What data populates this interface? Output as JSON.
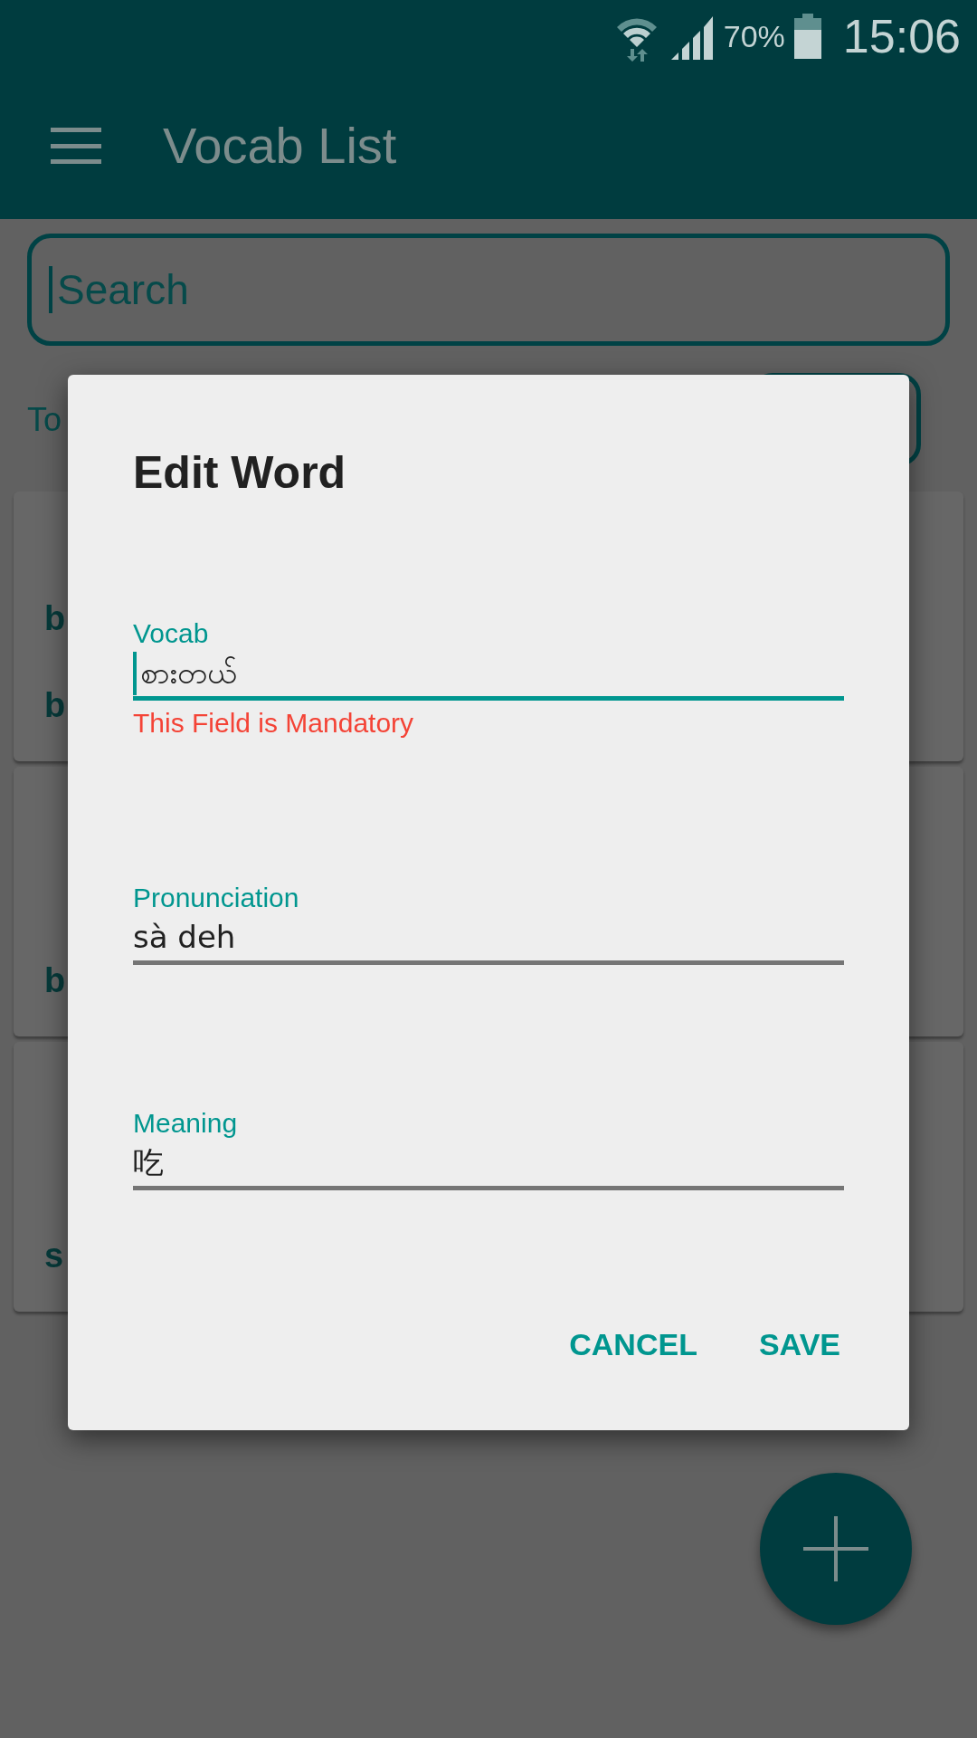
{
  "status_bar": {
    "battery": "70%",
    "time": "15:06"
  },
  "app_bar": {
    "title": "Vocab List"
  },
  "search": {
    "placeholder": "Search"
  },
  "total_label": "To",
  "cards": [
    {
      "lines": [
        "b",
        "b"
      ]
    },
    {
      "lines": [
        "b"
      ]
    },
    {
      "lines": [
        "s"
      ]
    }
  ],
  "dialog": {
    "title": "Edit Word",
    "fields": [
      {
        "label": "Vocab",
        "value": "စားတယ်",
        "focused": true,
        "error": "This Field is Mandatory"
      },
      {
        "label": "Pronunciation",
        "value": "sà deh",
        "focused": false
      },
      {
        "label": "Meaning",
        "value": "吃",
        "focused": false
      }
    ],
    "buttons": [
      "CANCEL",
      "SAVE"
    ]
  }
}
